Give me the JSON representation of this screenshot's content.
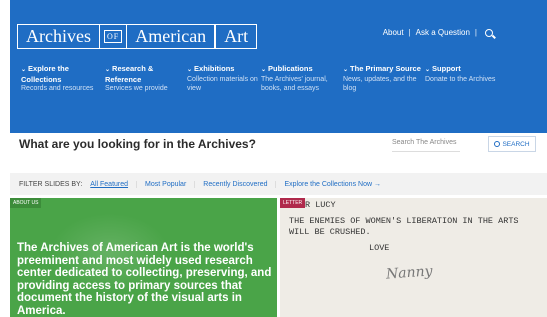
{
  "header": {
    "logo": {
      "part1": "Archives",
      "part2": "OF",
      "part3": "American",
      "part4": "Art"
    },
    "utility": {
      "about": "About",
      "ask": "Ask a Question"
    },
    "nav": [
      {
        "title": "Explore the Collections",
        "desc": "Records and resources"
      },
      {
        "title": "Research & Reference",
        "desc": "Services we provide"
      },
      {
        "title": "Exhibitions",
        "desc": "Collection materials on view"
      },
      {
        "title": "Publications",
        "desc": "The Archives' journal, books, and essays"
      },
      {
        "title": "The Primary Source",
        "desc": "News, updates, and the blog"
      },
      {
        "title": "Support",
        "desc": "Donate to the Archives"
      }
    ]
  },
  "search": {
    "title": "What are you looking for in the Archives?",
    "placeholder": "Search The Archives",
    "button": "SEARCH"
  },
  "filters": {
    "label": "FILTER SLIDES BY:",
    "items": [
      "All Featured",
      "Most Popular",
      "Recently Discovered",
      "Explore the Collections Now →"
    ]
  },
  "slides": [
    {
      "tag": "ABOUT US",
      "text": "The Archives of American Art is the world's preeminent and most widely used research center dedicated to collecting, preserving, and providing access to primary sources that document the history of the visual arts in America."
    },
    {
      "tag": "LETTER",
      "lines": [
        "R LUCY",
        "THE ENEMIES OF WOMEN'S LIBERATION IN THE ARTS",
        "WILL BE CRUSHED.",
        "LOVE"
      ]
    }
  ],
  "colors": {
    "brand_blue": "#1f6dc4",
    "green": "#4aa448",
    "letter_tag": "#b02a4c"
  }
}
